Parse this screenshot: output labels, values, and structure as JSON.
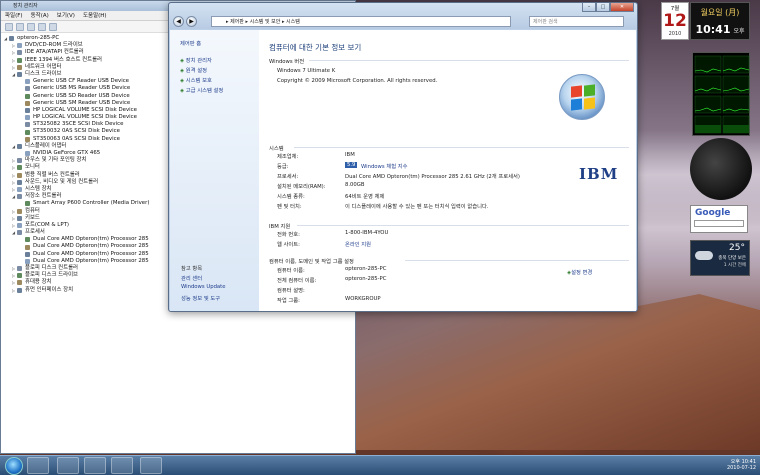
{
  "device_manager": {
    "title": "장치 관리자",
    "menu": [
      "파일(F)",
      "동작(A)",
      "보기(V)",
      "도움말(H)"
    ],
    "tree": [
      {
        "label": "opteron-285-PC",
        "level": 0,
        "expanded": true
      },
      {
        "label": "DVD/CD-ROM 드라이브",
        "level": 1
      },
      {
        "label": "IDE ATA/ATAPI 컨트롤러",
        "level": 1
      },
      {
        "label": "IEEE 1394 버스 호스트 컨트롤러",
        "level": 1
      },
      {
        "label": "네트워크 어댑터",
        "level": 1
      },
      {
        "label": "디스크 드라이브",
        "level": 1,
        "expanded": true
      },
      {
        "label": "Generic USB CF Reader USB Device",
        "level": 2
      },
      {
        "label": "Generic USB MS Reader USB Device",
        "level": 2
      },
      {
        "label": "Generic USB SD Reader USB Device",
        "level": 2
      },
      {
        "label": "Generic USB SM Reader USB Device",
        "level": 2
      },
      {
        "label": "HP LOGICAL VOLUME SCSI Disk Device",
        "level": 2
      },
      {
        "label": "HP LOGICAL VOLUME SCSI Disk Device",
        "level": 2
      },
      {
        "label": "ST325082 3SCE SCSI Disk Device",
        "level": 2
      },
      {
        "label": "ST350032 0AS SCSI Disk Device",
        "level": 2
      },
      {
        "label": "ST350063 0AS SCSI Disk Device",
        "level": 2
      },
      {
        "label": "디스플레이 어댑터",
        "level": 1,
        "expanded": true
      },
      {
        "label": "NVIDIA GeForce GTX 465",
        "level": 2
      },
      {
        "label": "마우스 및 기타 포인팅 장치",
        "level": 1
      },
      {
        "label": "모니터",
        "level": 1
      },
      {
        "label": "범용 직렬 버스 컨트롤러",
        "level": 1
      },
      {
        "label": "사운드, 비디오 및 게임 컨트롤러",
        "level": 1
      },
      {
        "label": "시스템 장치",
        "level": 1
      },
      {
        "label": "저장소 컨트롤러",
        "level": 1,
        "expanded": true
      },
      {
        "label": "Smart Array P600 Controller (Media Driver)",
        "level": 2
      },
      {
        "label": "컴퓨터",
        "level": 1
      },
      {
        "label": "키보드",
        "level": 1
      },
      {
        "label": "포트(COM & LPT)",
        "level": 1
      },
      {
        "label": "프로세서",
        "level": 1,
        "expanded": true
      },
      {
        "label": "Dual Core AMD Opteron(tm) Processor 285",
        "level": 2
      },
      {
        "label": "Dual Core AMD Opteron(tm) Processor 285",
        "level": 2
      },
      {
        "label": "Dual Core AMD Opteron(tm) Processor 285",
        "level": 2
      },
      {
        "label": "Dual Core AMD Opteron(tm) Processor 285",
        "level": 2
      },
      {
        "label": "플로피 디스크 컨트롤러",
        "level": 1
      },
      {
        "label": "플로피 디스크 드라이브",
        "level": 1
      },
      {
        "label": "휴대용 장치",
        "level": 1
      },
      {
        "label": "휴먼 인터페이스 장치",
        "level": 1
      }
    ]
  },
  "system_window": {
    "breadcrumb": "▸ 제어판 ▸ 시스템 및 보안 ▸ 시스템",
    "search_placeholder": "제어판 검색",
    "sidebar": {
      "home": "제어판 홈",
      "links": [
        "장치 관리자",
        "원격 설정",
        "시스템 보호",
        "고급 시스템 설정"
      ],
      "see_also_header": "참고 항목",
      "see_also": [
        "관리 센터",
        "Windows Update",
        "성능 정보 및 도구"
      ]
    },
    "heading": "컴퓨터에 대한 기본 정보 보기",
    "edition_header": "Windows 버전",
    "edition": "Windows 7 Ultimate K",
    "copyright": "Copyright © 2009 Microsoft Corporation. All rights reserved.",
    "system_header": "시스템",
    "system_rows": [
      {
        "label": "제조업체:",
        "value": "IBM"
      },
      {
        "label": "등급:",
        "value": "Windows 체험 지수"
      },
      {
        "label": "프로세서:",
        "value": "Dual Core AMD Opteron(tm) Processor 285   2.61 GHz (2개 프로세서)"
      },
      {
        "label": "설치된 메모리(RAM):",
        "value": "8.00GB"
      },
      {
        "label": "시스템 종류:",
        "value": "64비트 운영 체제"
      },
      {
        "label": "펜 및 터치:",
        "value": "이 디스플레이에 사용할 수 있는 펜 또는 터치식 입력이 없습니다."
      }
    ],
    "rating_badge": "5.9",
    "ibm_header": "IBM 지원",
    "ibm_rows": [
      {
        "label": "전화 번호:",
        "value": "1-800-IBM-4YOU"
      },
      {
        "label": "웹 사이트:",
        "value": "온라인 지원"
      }
    ],
    "computer_header": "컴퓨터 이름, 도메인 및 작업 그룹 설정",
    "computer_rows": [
      {
        "label": "컴퓨터 이름:",
        "value": "opteron-285-PC"
      },
      {
        "label": "전체 컴퓨터 이름:",
        "value": "opteron-285-PC"
      },
      {
        "label": "컴퓨터 설명:",
        "value": ""
      },
      {
        "label": "작업 그룹:",
        "value": "WORKGROUP"
      }
    ],
    "change_settings": "설정 변경",
    "oem_logo": "IBM"
  },
  "gadgets": {
    "cal_month": "7월",
    "cal_day": "12",
    "cal_year": "2010",
    "weekday": "월요일 (月)",
    "time": "10:41",
    "ampm": "오후",
    "google": "Google",
    "weather_temp": "25°",
    "weather_place": "충북 단양 보은",
    "weather_time": "1 시간 전에"
  },
  "taskbar": {
    "tray_time": "오후 10:41",
    "tray_date": "2010-07-12"
  }
}
